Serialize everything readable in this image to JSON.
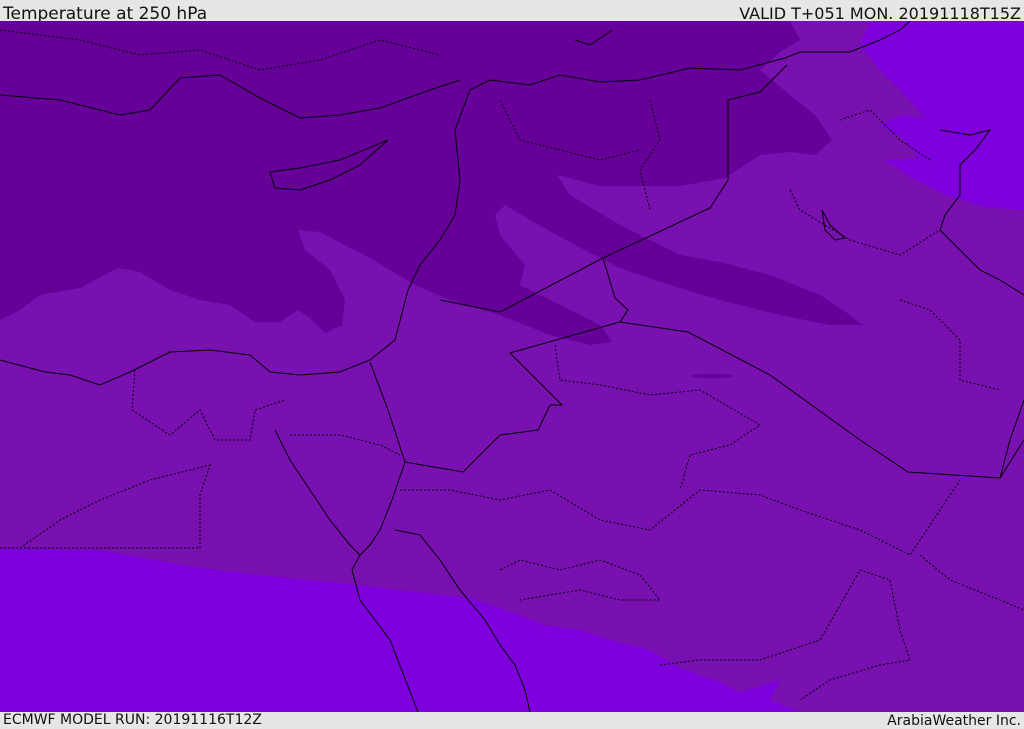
{
  "header": {
    "title": "Temperature at 250 hPa",
    "valid": "VALID T+051 MON. 20191118T15Z"
  },
  "footer": {
    "model_run": "ECMWF MODEL RUN: 20191116T12Z",
    "brand": "ArabiaWeather Inc."
  },
  "colors": {
    "cold": "#660099",
    "mid": "#7910b0",
    "warm": "#7e00dc",
    "border": "#000000"
  }
}
